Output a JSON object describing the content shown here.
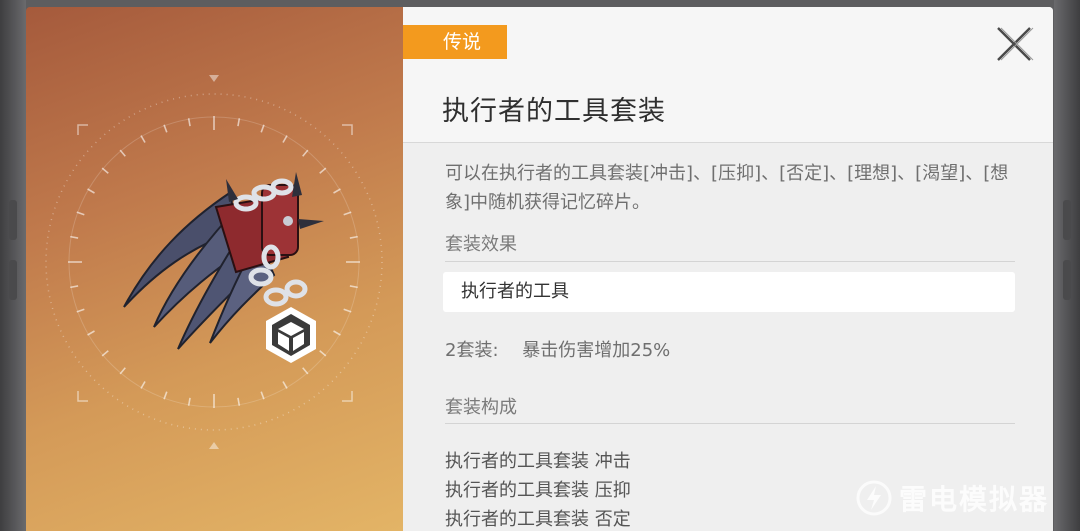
{
  "item": {
    "rarity": "传说",
    "title": "执行者的工具套装",
    "description": "可以在执行者的工具套装[冲击]、[压抑]、[否定]、[理想]、[渴望]、[想象]中随机获得记忆碎片。",
    "set_effect_label": "套装效果",
    "set_name": "执行者的工具",
    "bonus_label": "2套装:",
    "bonus_value": "暴击伤害增加25%",
    "composition_label": "套装构成",
    "components": [
      "执行者的工具套装 冲击",
      "执行者的工具套装 压抑",
      "执行者的工具套装 否定"
    ]
  },
  "icons": {
    "close": "close-icon",
    "item_type": "cube-icon",
    "art": "claw-gauntlet-item-art"
  },
  "watermark": {
    "text": "雷电模拟器"
  },
  "colors": {
    "rarity_legendary": "#f39a1e",
    "panel_bg": "#efefef",
    "art_gradient_top": "#a55a3c",
    "art_gradient_bottom": "#e3b466"
  }
}
